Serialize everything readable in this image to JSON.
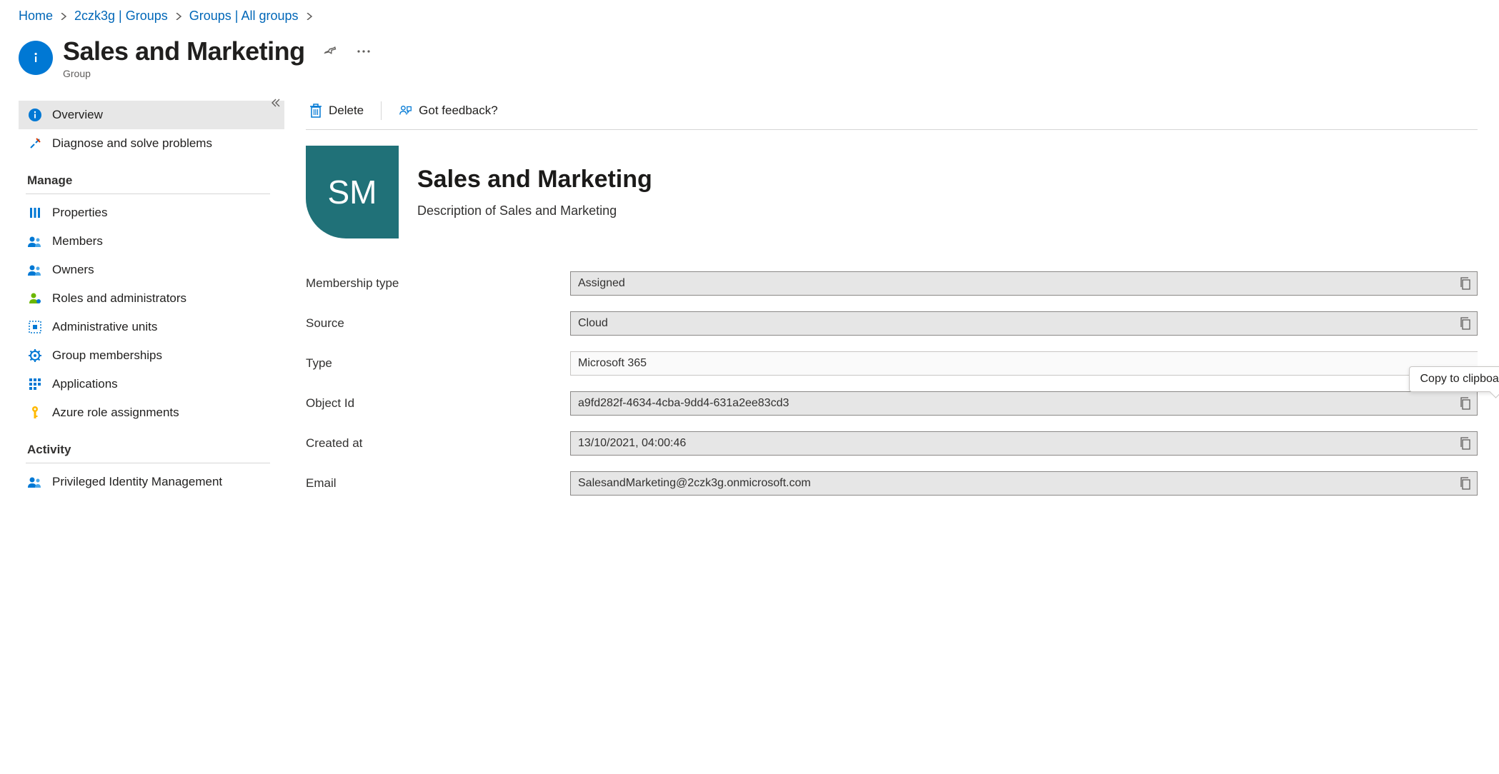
{
  "breadcrumb": {
    "items": [
      {
        "label": "Home"
      },
      {
        "label": "2czk3g | Groups"
      },
      {
        "label": "Groups | All groups"
      }
    ]
  },
  "header": {
    "title": "Sales and Marketing",
    "subtitle": "Group"
  },
  "toolbar": {
    "delete": "Delete",
    "feedback": "Got feedback?"
  },
  "sidebar": {
    "overview": "Overview",
    "diagnose": "Diagnose and solve problems",
    "section_manage": "Manage",
    "properties": "Properties",
    "members": "Members",
    "owners": "Owners",
    "roles": "Roles and administrators",
    "admin_units": "Administrative units",
    "group_memberships": "Group memberships",
    "applications": "Applications",
    "azure_role": "Azure role assignments",
    "section_activity": "Activity",
    "pim": "Privileged Identity Management"
  },
  "summary": {
    "initials": "SM",
    "title": "Sales and Marketing",
    "description": "Description of Sales and Marketing"
  },
  "props": {
    "membership_type": {
      "label": "Membership type",
      "value": "Assigned"
    },
    "source": {
      "label": "Source",
      "value": "Cloud"
    },
    "type": {
      "label": "Type",
      "value": "Microsoft 365"
    },
    "object_id": {
      "label": "Object Id",
      "value": "a9fd282f-4634-4cba-9dd4-631a2ee83cd3"
    },
    "created_at": {
      "label": "Created at",
      "value": "13/10/2021, 04:00:46"
    },
    "email": {
      "label": "Email",
      "value": "SalesandMarketing@2czk3g.onmicrosoft.com"
    }
  },
  "tooltip": {
    "copy": "Copy to clipboard"
  }
}
